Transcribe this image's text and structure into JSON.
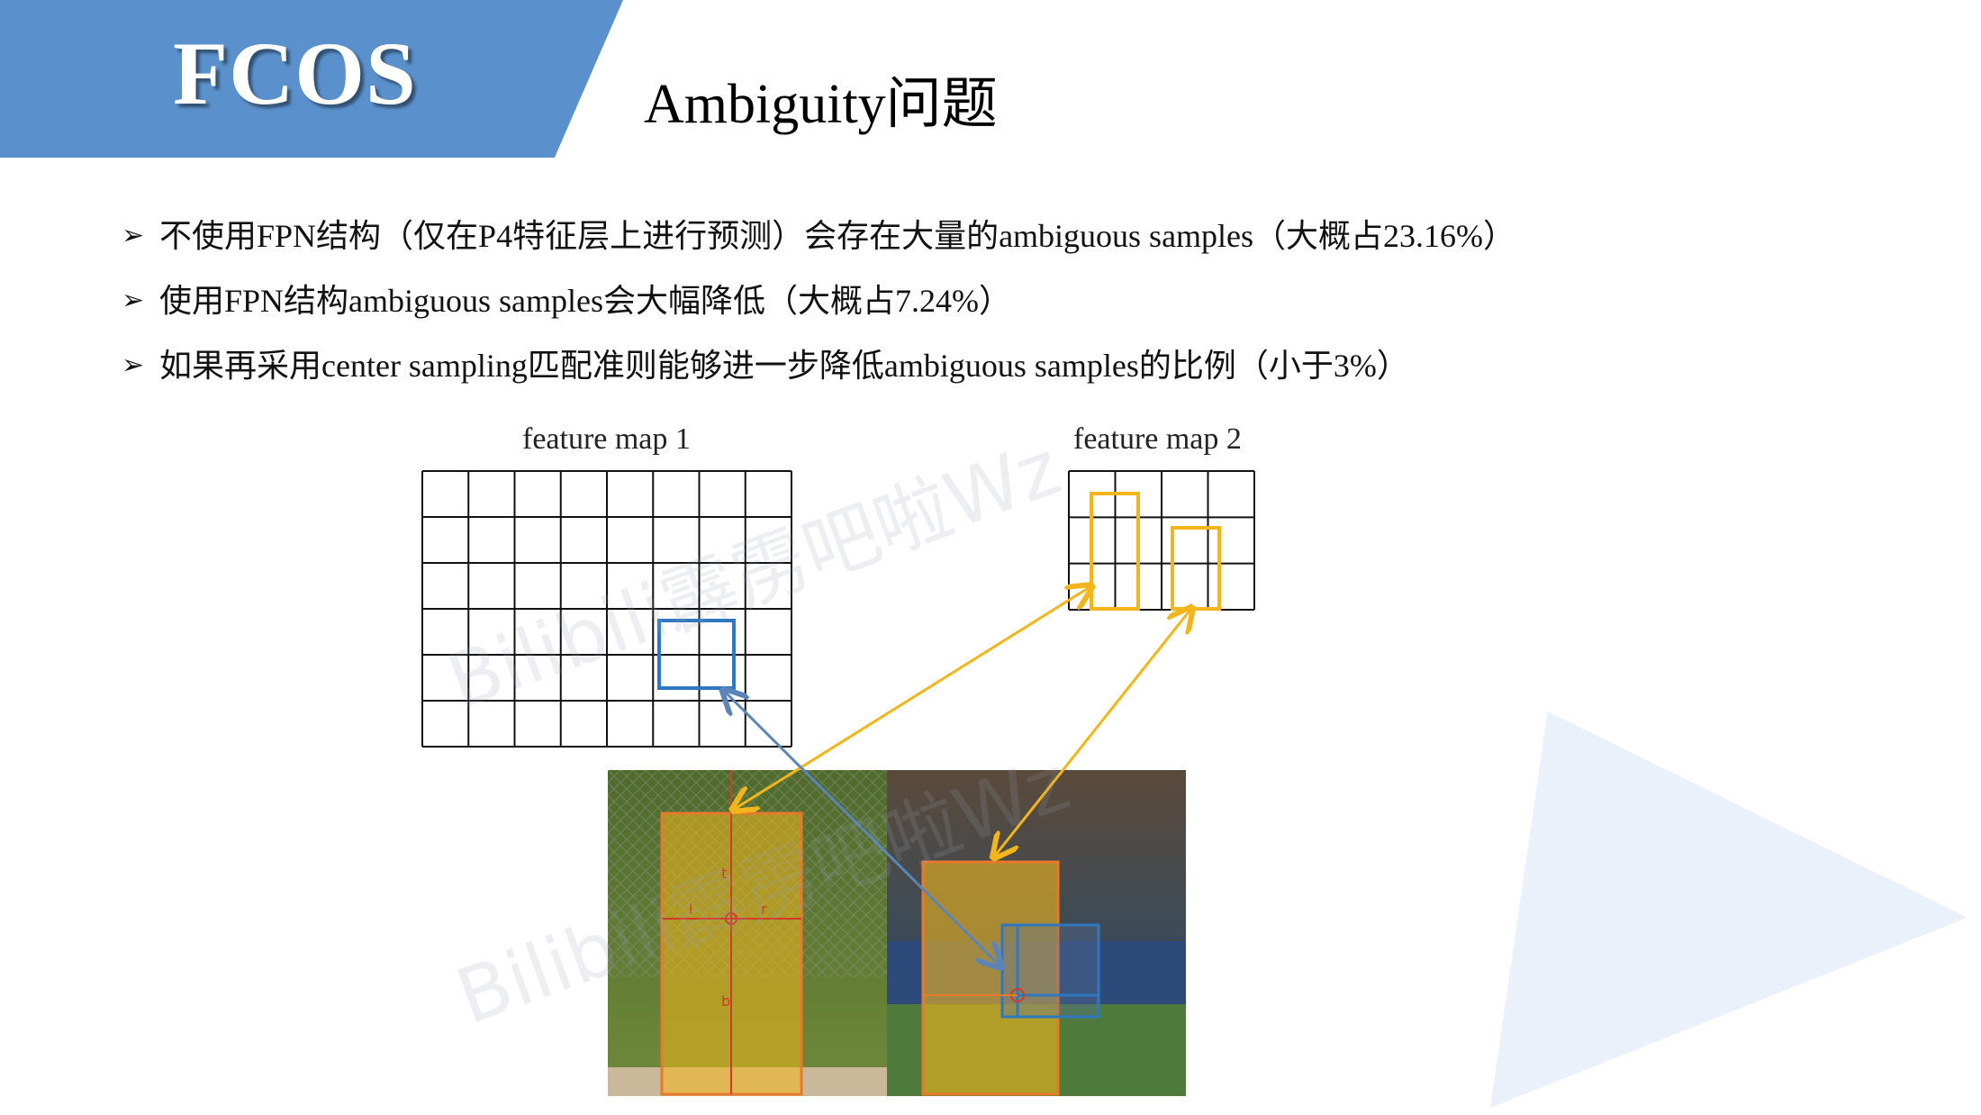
{
  "banner": {
    "title": "FCOS"
  },
  "slide": {
    "title": "Ambiguity问题"
  },
  "bullets": [
    "不使用FPN结构（仅在P4特征层上进行预测）会存在大量的ambiguous samples（大概占23.16%）",
    "使用FPN结构ambiguous samples会大幅降低（大概占7.24%）",
    "如果再采用center sampling匹配准则能够进一步降低ambiguous samples的比例（小于3%）"
  ],
  "figure": {
    "map1_label": "feature map 1",
    "map2_label": "feature map 2",
    "map1_grid": {
      "rows": 6,
      "cols": 8
    },
    "map2_grid": {
      "rows": 3,
      "cols": 4
    },
    "box_labels": [
      "t",
      "l",
      "r",
      "b"
    ],
    "colors": {
      "blue_box": "#2f78c0",
      "yellow_box": "#f2b61c",
      "orange_box": "#e8792b",
      "red_arrow": "#d23a2a",
      "grid_line": "#111111",
      "banner": "#5a90cb"
    }
  },
  "watermark": {
    "line1": "Bilibili霹雳吧啦Wz",
    "line2": "Bilibili霹雳吧啦Wz"
  }
}
